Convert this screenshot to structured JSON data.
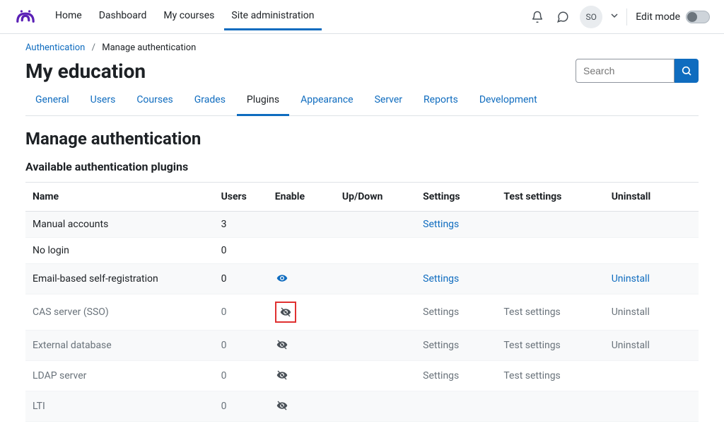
{
  "topnav": {
    "items": [
      {
        "label": "Home",
        "active": false
      },
      {
        "label": "Dashboard",
        "active": false
      },
      {
        "label": "My courses",
        "active": false
      },
      {
        "label": "Site administration",
        "active": true
      }
    ]
  },
  "user": {
    "initials": "SO"
  },
  "editmode": {
    "label": "Edit mode"
  },
  "breadcrumb": {
    "parent": "Authentication",
    "current": "Manage authentication"
  },
  "page_title": "My education",
  "search": {
    "placeholder": "Search"
  },
  "tabs": [
    {
      "label": "General",
      "active": false
    },
    {
      "label": "Users",
      "active": false
    },
    {
      "label": "Courses",
      "active": false
    },
    {
      "label": "Grades",
      "active": false
    },
    {
      "label": "Plugins",
      "active": true
    },
    {
      "label": "Appearance",
      "active": false
    },
    {
      "label": "Server",
      "active": false
    },
    {
      "label": "Reports",
      "active": false
    },
    {
      "label": "Development",
      "active": false
    }
  ],
  "section_title": "Manage authentication",
  "subsection_title": "Available authentication plugins",
  "table": {
    "headers": {
      "name": "Name",
      "users": "Users",
      "enable": "Enable",
      "updown": "Up/Down",
      "settings": "Settings",
      "test": "Test settings",
      "uninstall": "Uninstall"
    },
    "rows": [
      {
        "name": "Manual accounts",
        "users": "3",
        "enable": "",
        "settings": "Settings",
        "test": "",
        "uninstall": "",
        "disabled": false,
        "highlight": false
      },
      {
        "name": "No login",
        "users": "0",
        "enable": "",
        "settings": "",
        "test": "",
        "uninstall": "",
        "disabled": false,
        "highlight": false
      },
      {
        "name": "Email-based self-registration",
        "users": "0",
        "enable": "eye",
        "settings": "Settings",
        "test": "",
        "uninstall": "Uninstall",
        "disabled": false,
        "highlight": false
      },
      {
        "name": "CAS server (SSO)",
        "users": "0",
        "enable": "eye-off",
        "settings": "Settings",
        "test": "Test settings",
        "uninstall": "Uninstall",
        "disabled": true,
        "highlight": true
      },
      {
        "name": "External database",
        "users": "0",
        "enable": "eye-off",
        "settings": "Settings",
        "test": "Test settings",
        "uninstall": "Uninstall",
        "disabled": true,
        "highlight": false
      },
      {
        "name": "LDAP server",
        "users": "0",
        "enable": "eye-off",
        "settings": "Settings",
        "test": "Test settings",
        "uninstall": "",
        "disabled": true,
        "highlight": false
      },
      {
        "name": "LTI",
        "users": "0",
        "enable": "eye-off",
        "settings": "",
        "test": "",
        "uninstall": "",
        "disabled": true,
        "highlight": false
      }
    ]
  }
}
